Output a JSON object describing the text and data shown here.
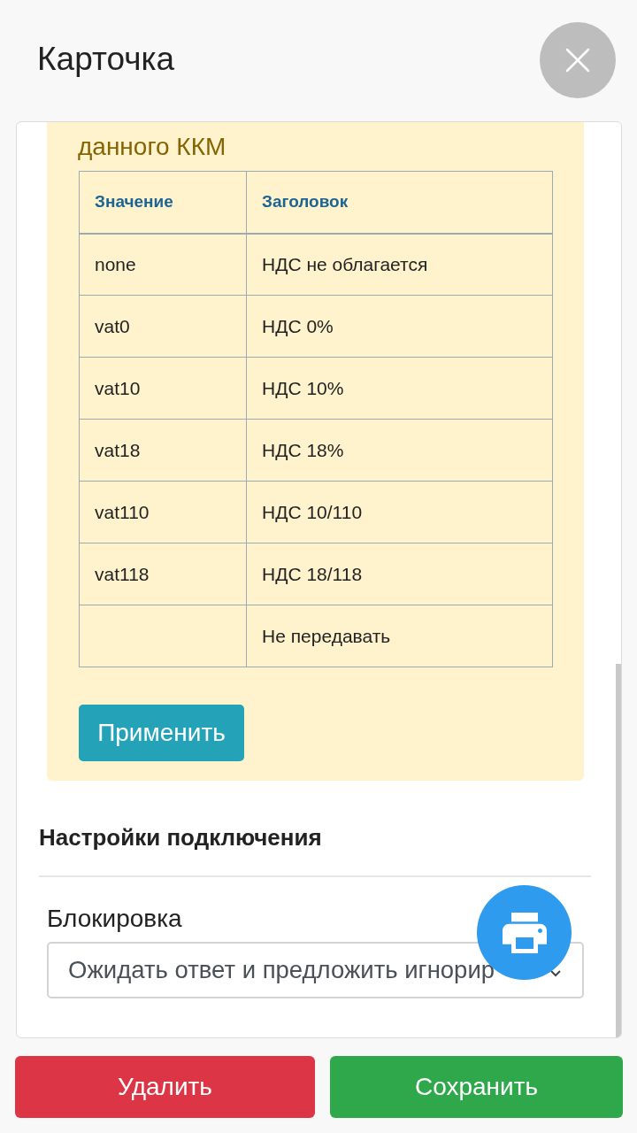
{
  "header": {
    "title": "Карточка"
  },
  "alert": {
    "text": "данного ККМ",
    "table": {
      "columns": [
        "Значение",
        "Заголовок"
      ],
      "rows": [
        {
          "value": "none",
          "title": "НДС не облагается"
        },
        {
          "value": "vat0",
          "title": "НДС 0%"
        },
        {
          "value": "vat10",
          "title": "НДС 10%"
        },
        {
          "value": "vat18",
          "title": "НДС 18%"
        },
        {
          "value": "vat110",
          "title": "НДС 10/110"
        },
        {
          "value": "vat118",
          "title": "НДС 18/118"
        },
        {
          "title": "Не передавать"
        }
      ]
    },
    "apply_button": "Применить"
  },
  "connection_section": {
    "title": "Настройки подключения",
    "fields": [
      {
        "kind": "select",
        "label": "Блокировка",
        "value": "Ожидать ответ и предложить игнорир"
      }
    ]
  },
  "buttons": [
    {
      "kind": "delete",
      "label": "Удалить"
    },
    {
      "kind": "save",
      "label": "Сохранить"
    }
  ]
}
